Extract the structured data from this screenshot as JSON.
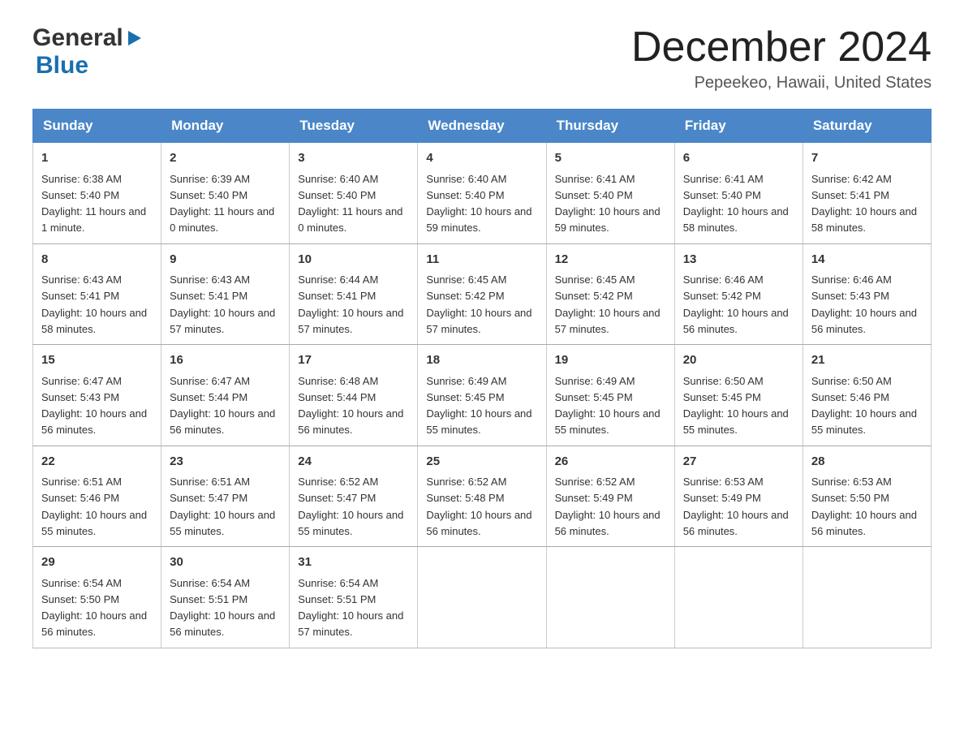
{
  "header": {
    "logo": {
      "text_general": "General",
      "text_blue": "Blue",
      "arrow_unicode": "▶"
    },
    "title": "December 2024",
    "location": "Pepeekeo, Hawaii, United States"
  },
  "calendar": {
    "weekdays": [
      "Sunday",
      "Monday",
      "Tuesday",
      "Wednesday",
      "Thursday",
      "Friday",
      "Saturday"
    ],
    "weeks": [
      [
        {
          "day": "1",
          "sunrise": "6:38 AM",
          "sunset": "5:40 PM",
          "daylight": "11 hours and 1 minute."
        },
        {
          "day": "2",
          "sunrise": "6:39 AM",
          "sunset": "5:40 PM",
          "daylight": "11 hours and 0 minutes."
        },
        {
          "day": "3",
          "sunrise": "6:40 AM",
          "sunset": "5:40 PM",
          "daylight": "11 hours and 0 minutes."
        },
        {
          "day": "4",
          "sunrise": "6:40 AM",
          "sunset": "5:40 PM",
          "daylight": "10 hours and 59 minutes."
        },
        {
          "day": "5",
          "sunrise": "6:41 AM",
          "sunset": "5:40 PM",
          "daylight": "10 hours and 59 minutes."
        },
        {
          "day": "6",
          "sunrise": "6:41 AM",
          "sunset": "5:40 PM",
          "daylight": "10 hours and 58 minutes."
        },
        {
          "day": "7",
          "sunrise": "6:42 AM",
          "sunset": "5:41 PM",
          "daylight": "10 hours and 58 minutes."
        }
      ],
      [
        {
          "day": "8",
          "sunrise": "6:43 AM",
          "sunset": "5:41 PM",
          "daylight": "10 hours and 58 minutes."
        },
        {
          "day": "9",
          "sunrise": "6:43 AM",
          "sunset": "5:41 PM",
          "daylight": "10 hours and 57 minutes."
        },
        {
          "day": "10",
          "sunrise": "6:44 AM",
          "sunset": "5:41 PM",
          "daylight": "10 hours and 57 minutes."
        },
        {
          "day": "11",
          "sunrise": "6:45 AM",
          "sunset": "5:42 PM",
          "daylight": "10 hours and 57 minutes."
        },
        {
          "day": "12",
          "sunrise": "6:45 AM",
          "sunset": "5:42 PM",
          "daylight": "10 hours and 57 minutes."
        },
        {
          "day": "13",
          "sunrise": "6:46 AM",
          "sunset": "5:42 PM",
          "daylight": "10 hours and 56 minutes."
        },
        {
          "day": "14",
          "sunrise": "6:46 AM",
          "sunset": "5:43 PM",
          "daylight": "10 hours and 56 minutes."
        }
      ],
      [
        {
          "day": "15",
          "sunrise": "6:47 AM",
          "sunset": "5:43 PM",
          "daylight": "10 hours and 56 minutes."
        },
        {
          "day": "16",
          "sunrise": "6:47 AM",
          "sunset": "5:44 PM",
          "daylight": "10 hours and 56 minutes."
        },
        {
          "day": "17",
          "sunrise": "6:48 AM",
          "sunset": "5:44 PM",
          "daylight": "10 hours and 56 minutes."
        },
        {
          "day": "18",
          "sunrise": "6:49 AM",
          "sunset": "5:45 PM",
          "daylight": "10 hours and 55 minutes."
        },
        {
          "day": "19",
          "sunrise": "6:49 AM",
          "sunset": "5:45 PM",
          "daylight": "10 hours and 55 minutes."
        },
        {
          "day": "20",
          "sunrise": "6:50 AM",
          "sunset": "5:45 PM",
          "daylight": "10 hours and 55 minutes."
        },
        {
          "day": "21",
          "sunrise": "6:50 AM",
          "sunset": "5:46 PM",
          "daylight": "10 hours and 55 minutes."
        }
      ],
      [
        {
          "day": "22",
          "sunrise": "6:51 AM",
          "sunset": "5:46 PM",
          "daylight": "10 hours and 55 minutes."
        },
        {
          "day": "23",
          "sunrise": "6:51 AM",
          "sunset": "5:47 PM",
          "daylight": "10 hours and 55 minutes."
        },
        {
          "day": "24",
          "sunrise": "6:52 AM",
          "sunset": "5:47 PM",
          "daylight": "10 hours and 55 minutes."
        },
        {
          "day": "25",
          "sunrise": "6:52 AM",
          "sunset": "5:48 PM",
          "daylight": "10 hours and 56 minutes."
        },
        {
          "day": "26",
          "sunrise": "6:52 AM",
          "sunset": "5:49 PM",
          "daylight": "10 hours and 56 minutes."
        },
        {
          "day": "27",
          "sunrise": "6:53 AM",
          "sunset": "5:49 PM",
          "daylight": "10 hours and 56 minutes."
        },
        {
          "day": "28",
          "sunrise": "6:53 AM",
          "sunset": "5:50 PM",
          "daylight": "10 hours and 56 minutes."
        }
      ],
      [
        {
          "day": "29",
          "sunrise": "6:54 AM",
          "sunset": "5:50 PM",
          "daylight": "10 hours and 56 minutes."
        },
        {
          "day": "30",
          "sunrise": "6:54 AM",
          "sunset": "5:51 PM",
          "daylight": "10 hours and 56 minutes."
        },
        {
          "day": "31",
          "sunrise": "6:54 AM",
          "sunset": "5:51 PM",
          "daylight": "10 hours and 57 minutes."
        },
        null,
        null,
        null,
        null
      ]
    ]
  }
}
